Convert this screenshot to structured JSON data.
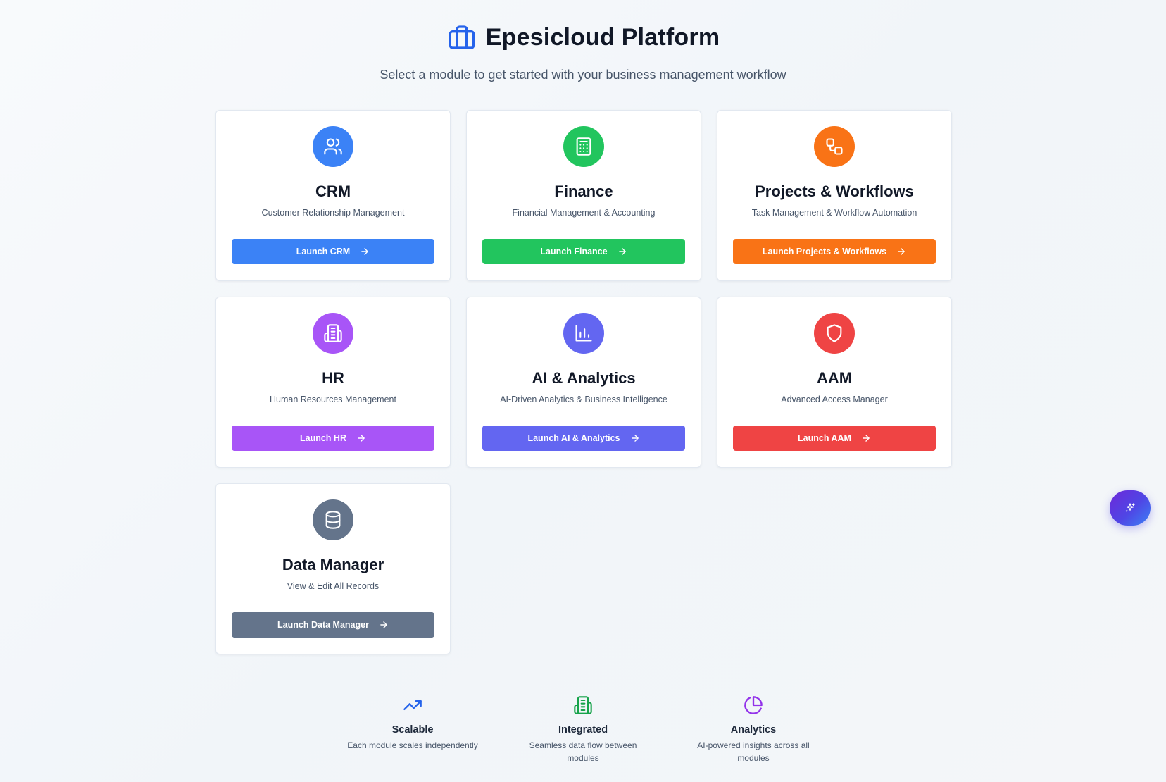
{
  "header": {
    "title": "Epesicloud Platform",
    "subtitle": "Select a module to get started with your business management workflow",
    "icon": "briefcase-icon",
    "icon_color": "#2563eb"
  },
  "modules": [
    {
      "name": "CRM",
      "description": "Customer Relationship Management",
      "button": "Launch CRM",
      "icon": "users-icon",
      "color": "#3b82f6"
    },
    {
      "name": "Finance",
      "description": "Financial Management & Accounting",
      "button": "Launch Finance",
      "icon": "calculator-icon",
      "color": "#22c55e"
    },
    {
      "name": "Projects & Workflows",
      "description": "Task Management & Workflow Automation",
      "button": "Launch Projects & Workflows",
      "icon": "workflow-icon",
      "color": "#f97316"
    },
    {
      "name": "HR",
      "description": "Human Resources Management",
      "button": "Launch HR",
      "icon": "building-icon",
      "color": "#a855f7"
    },
    {
      "name": "AI & Analytics",
      "description": "AI-Driven Analytics & Business Intelligence",
      "button": "Launch AI & Analytics",
      "icon": "bar-chart-icon",
      "color": "#6366f1"
    },
    {
      "name": "AAM",
      "description": "Advanced Access Manager",
      "button": "Launch AAM",
      "icon": "shield-icon",
      "color": "#ef4444"
    },
    {
      "name": "Data Manager",
      "description": "View & Edit All Records",
      "button": "Launch Data Manager",
      "icon": "database-icon",
      "color": "#64748b"
    }
  ],
  "features": [
    {
      "title": "Scalable",
      "description": "Each module scales independently",
      "icon": "trending-up-icon",
      "color": "#2563eb"
    },
    {
      "title": "Integrated",
      "description": "Seamless data flow between modules",
      "icon": "building-icon",
      "color": "#16a34a"
    },
    {
      "title": "Analytics",
      "description": "AI-powered insights across all modules",
      "icon": "pie-chart-icon",
      "color": "#9333ea"
    }
  ],
  "assistant_button": {
    "icon": "sparkles-icon"
  }
}
